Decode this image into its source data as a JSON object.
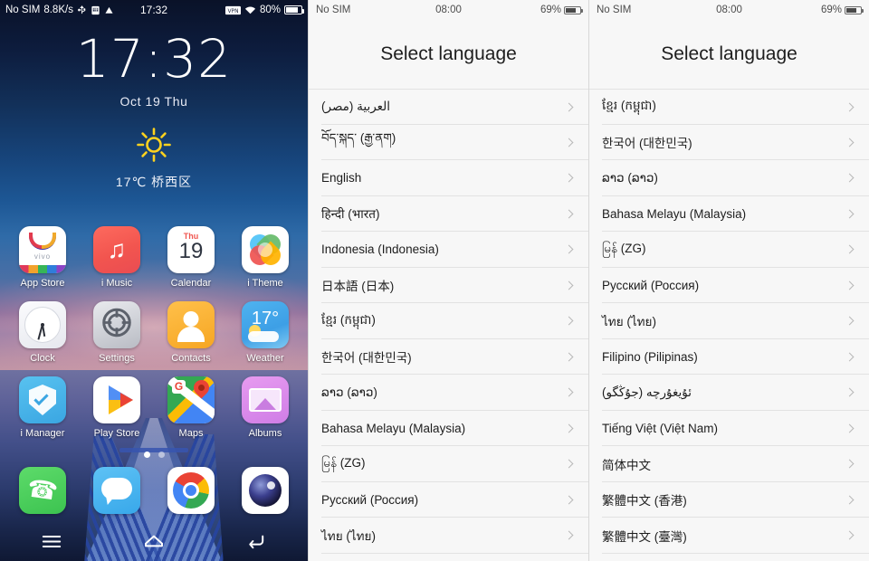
{
  "home": {
    "status_bar": {
      "carrier": "No SIM",
      "network_speed": "8.8K/s",
      "icons": [
        "usb-icon",
        "sim-card-icon",
        "triangle-warning-icon"
      ],
      "time": "17:32",
      "vpn_label": "VPN",
      "wifi_icon": "wifi-icon",
      "battery_percent": "80%"
    },
    "clock": {
      "time": "17:32",
      "date": "Oct 19  Thu"
    },
    "weather": {
      "icon": "sun-icon",
      "text": "17℃  桥西区"
    },
    "app_rows": [
      [
        {
          "label": "App Store",
          "icon": "vivo-appstore-icon"
        },
        {
          "label": "i Music",
          "icon": "music-note-icon"
        },
        {
          "label": "Calendar",
          "icon": "calendar-icon",
          "day_name": "Thu",
          "day_num": "19"
        },
        {
          "label": "i Theme",
          "icon": "theme-petals-icon"
        }
      ],
      [
        {
          "label": "Clock",
          "icon": "analog-clock-icon"
        },
        {
          "label": "Settings",
          "icon": "gear-icon"
        },
        {
          "label": "Contacts",
          "icon": "person-icon"
        },
        {
          "label": "Weather",
          "icon": "weather-sun-cloud-icon",
          "temp": "17°"
        }
      ],
      [
        {
          "label": "i Manager",
          "icon": "shield-check-icon"
        },
        {
          "label": "Play Store",
          "icon": "play-store-icon"
        },
        {
          "label": "Maps",
          "icon": "google-maps-icon",
          "glyph": "G"
        },
        {
          "label": "Albums",
          "icon": "photo-frame-icon"
        }
      ]
    ],
    "page_dots": {
      "count": 2,
      "active_index": 0
    },
    "dock": [
      {
        "label": "Phone",
        "icon": "phone-icon"
      },
      {
        "label": "Messages",
        "icon": "message-bubble-icon"
      },
      {
        "label": "Chrome",
        "icon": "chrome-icon"
      },
      {
        "label": "Camera",
        "icon": "camera-lens-icon"
      }
    ],
    "nav_bar": [
      {
        "name": "menu-button",
        "icon": "hamburger-icon"
      },
      {
        "name": "home-button",
        "icon": "home-icon"
      },
      {
        "name": "back-button",
        "icon": "back-arrow-icon"
      }
    ]
  },
  "lang_status_bar": {
    "carrier": "No SIM",
    "time": "08:00",
    "battery_percent": "69%"
  },
  "lang_panel_mid": {
    "title": "Select language",
    "items": [
      "العربية (مصر)",
      "བོད་སྐད་ (རྒྱ་ནག)",
      "English",
      "हिन्दी (भारत)",
      "Indonesia (Indonesia)",
      "日本語 (日本)",
      "ខ្មែរ (កម្ពុជា)",
      "한국어 (대한민국)",
      "ລາວ (ລາວ)",
      "Bahasa Melayu (Malaysia)",
      "မြန် (ZG)",
      "Русский (Россия)",
      "ไทย (ไทย)"
    ]
  },
  "lang_panel_right": {
    "title": "Select language",
    "items": [
      "ខ្មែរ (កម្ពុជា)",
      "한국어 (대한민국)",
      "ລາວ (ລາວ)",
      "Bahasa Melayu (Malaysia)",
      "မြန် (ZG)",
      "Русский (Россия)",
      "ไทย (ไทย)",
      "Filipino (Pilipinas)",
      "ئۇيغۇرچە (جۇڭگو)",
      "Tiếng Việt (Việt Nam)",
      "简体中文",
      "繁體中文 (香港)",
      "繁體中文 (臺灣)"
    ]
  },
  "colors": {
    "accent_blue": "#3aa6e2",
    "list_bg": "#f7f7f7",
    "divider": "#e2e2e2",
    "text_dark": "#1d1d1d"
  }
}
